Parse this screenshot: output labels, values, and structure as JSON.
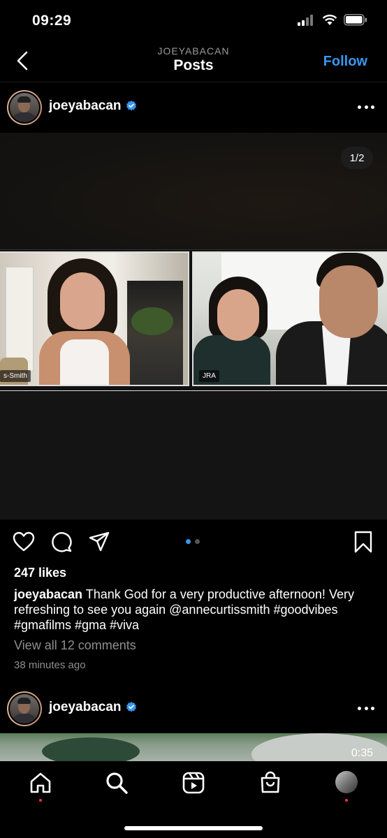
{
  "status": {
    "time": "09:29"
  },
  "nav": {
    "subtitle": "JOEYABACAN",
    "title": "Posts",
    "follow_label": "Follow"
  },
  "post1": {
    "username": "joeyabacan",
    "media_counter": "1/2",
    "tile_left_label": "s-Smith",
    "tile_right_label": "JRA",
    "likes": "247 likes",
    "caption_user": "joeyabacan",
    "caption_text": "Thank God for a very productive afternoon! Very refreshing to see you again @annecurtissmith #goodvibes #gmafilms #gma #viva",
    "view_comments": "View all 12 comments",
    "time_ago": "38 minutes ago",
    "carousel": {
      "count": 2,
      "active_index": 0
    }
  },
  "post2": {
    "username": "joeyabacan",
    "video_time": "0:35"
  },
  "icons": {
    "back": "chevron-left-icon",
    "verified": "verified-badge-icon",
    "more": "more-icon",
    "like": "heart-icon",
    "comment": "comment-icon",
    "share": "send-icon",
    "save": "bookmark-icon",
    "home": "home-icon",
    "search": "search-icon",
    "reels": "reels-icon",
    "shop": "shop-icon"
  },
  "colors": {
    "accent": "#3897f0",
    "notification": "#ff3040",
    "background": "#000000"
  }
}
